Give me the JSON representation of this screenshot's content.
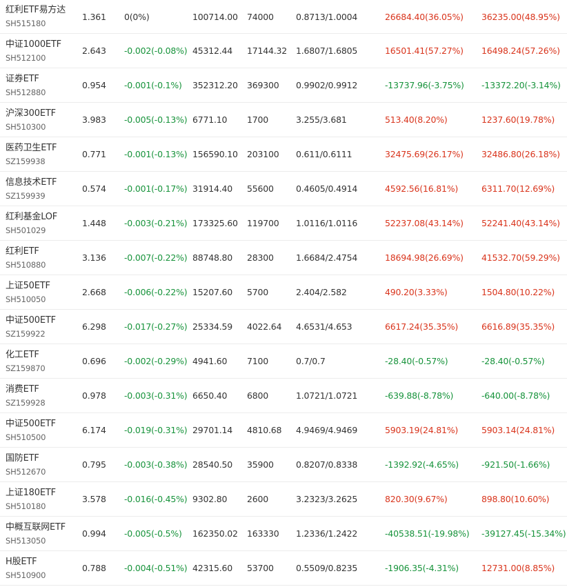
{
  "colors": {
    "up": "#d9341c",
    "down": "#17933b",
    "flat": "#333333"
  },
  "rows": [
    {
      "name": "红利ETF易方达",
      "code": "SH515180",
      "price": "1.361",
      "change": "0(0%)",
      "change_dir": "flat",
      "v1": "100714.00",
      "v2": "74000",
      "ratio": "0.8713/1.0004",
      "p1": "26684.40(36.05%)",
      "p1_dir": "up",
      "p2": "36235.00(48.95%)",
      "p2_dir": "up"
    },
    {
      "name": "中证1000ETF",
      "code": "SH512100",
      "price": "2.643",
      "change": "-0.002(-0.08%)",
      "change_dir": "down",
      "v1": "45312.44",
      "v2": "17144.32",
      "ratio": "1.6807/1.6805",
      "p1": "16501.41(57.27%)",
      "p1_dir": "up",
      "p2": "16498.24(57.26%)",
      "p2_dir": "up"
    },
    {
      "name": "证券ETF",
      "code": "SH512880",
      "price": "0.954",
      "change": "-0.001(-0.1%)",
      "change_dir": "down",
      "v1": "352312.20",
      "v2": "369300",
      "ratio": "0.9902/0.9912",
      "p1": "-13737.96(-3.75%)",
      "p1_dir": "down",
      "p2": "-13372.20(-3.14%)",
      "p2_dir": "down"
    },
    {
      "name": "沪深300ETF",
      "code": "SH510300",
      "price": "3.983",
      "change": "-0.005(-0.13%)",
      "change_dir": "down",
      "v1": "6771.10",
      "v2": "1700",
      "ratio": "3.255/3.681",
      "p1": "513.40(8.20%)",
      "p1_dir": "up",
      "p2": "1237.60(19.78%)",
      "p2_dir": "up"
    },
    {
      "name": "医药卫生ETF",
      "code": "SZ159938",
      "price": "0.771",
      "change": "-0.001(-0.13%)",
      "change_dir": "down",
      "v1": "156590.10",
      "v2": "203100",
      "ratio": "0.611/0.6111",
      "p1": "32475.69(26.17%)",
      "p1_dir": "up",
      "p2": "32486.80(26.18%)",
      "p2_dir": "up"
    },
    {
      "name": "信息技术ETF",
      "code": "SZ159939",
      "price": "0.574",
      "change": "-0.001(-0.17%)",
      "change_dir": "down",
      "v1": "31914.40",
      "v2": "55600",
      "ratio": "0.4605/0.4914",
      "p1": "4592.56(16.81%)",
      "p1_dir": "up",
      "p2": "6311.70(12.69%)",
      "p2_dir": "up"
    },
    {
      "name": "红利基金LOF",
      "code": "SH501029",
      "price": "1.448",
      "change": "-0.003(-0.21%)",
      "change_dir": "down",
      "v1": "173325.60",
      "v2": "119700",
      "ratio": "1.0116/1.0116",
      "p1": "52237.08(43.14%)",
      "p1_dir": "up",
      "p2": "52241.40(43.14%)",
      "p2_dir": "up"
    },
    {
      "name": "红利ETF",
      "code": "SH510880",
      "price": "3.136",
      "change": "-0.007(-0.22%)",
      "change_dir": "down",
      "v1": "88748.80",
      "v2": "28300",
      "ratio": "1.6684/2.4754",
      "p1": "18694.98(26.69%)",
      "p1_dir": "up",
      "p2": "41532.70(59.29%)",
      "p2_dir": "up"
    },
    {
      "name": "上证50ETF",
      "code": "SH510050",
      "price": "2.668",
      "change": "-0.006(-0.22%)",
      "change_dir": "down",
      "v1": "15207.60",
      "v2": "5700",
      "ratio": "2.404/2.582",
      "p1": "490.20(3.33%)",
      "p1_dir": "up",
      "p2": "1504.80(10.22%)",
      "p2_dir": "up"
    },
    {
      "name": "中证500ETF",
      "code": "SZ159922",
      "price": "6.298",
      "change": "-0.017(-0.27%)",
      "change_dir": "down",
      "v1": "25334.59",
      "v2": "4022.64",
      "ratio": "4.6531/4.653",
      "p1": "6617.24(35.35%)",
      "p1_dir": "up",
      "p2": "6616.89(35.35%)",
      "p2_dir": "up"
    },
    {
      "name": "化工ETF",
      "code": "SZ159870",
      "price": "0.696",
      "change": "-0.002(-0.29%)",
      "change_dir": "down",
      "v1": "4941.60",
      "v2": "7100",
      "ratio": "0.7/0.7",
      "p1": "-28.40(-0.57%)",
      "p1_dir": "down",
      "p2": "-28.40(-0.57%)",
      "p2_dir": "down"
    },
    {
      "name": "消费ETF",
      "code": "SZ159928",
      "price": "0.978",
      "change": "-0.003(-0.31%)",
      "change_dir": "down",
      "v1": "6650.40",
      "v2": "6800",
      "ratio": "1.0721/1.0721",
      "p1": "-639.88(-8.78%)",
      "p1_dir": "down",
      "p2": "-640.00(-8.78%)",
      "p2_dir": "down"
    },
    {
      "name": "中证500ETF",
      "code": "SH510500",
      "price": "6.174",
      "change": "-0.019(-0.31%)",
      "change_dir": "down",
      "v1": "29701.14",
      "v2": "4810.68",
      "ratio": "4.9469/4.9469",
      "p1": "5903.19(24.81%)",
      "p1_dir": "up",
      "p2": "5903.14(24.81%)",
      "p2_dir": "up"
    },
    {
      "name": "国防ETF",
      "code": "SH512670",
      "price": "0.795",
      "change": "-0.003(-0.38%)",
      "change_dir": "down",
      "v1": "28540.50",
      "v2": "35900",
      "ratio": "0.8207/0.8338",
      "p1": "-1392.92(-4.65%)",
      "p1_dir": "down",
      "p2": "-921.50(-1.66%)",
      "p2_dir": "down"
    },
    {
      "name": "上证180ETF",
      "code": "SH510180",
      "price": "3.578",
      "change": "-0.016(-0.45%)",
      "change_dir": "down",
      "v1": "9302.80",
      "v2": "2600",
      "ratio": "3.2323/3.2625",
      "p1": "820.30(9.67%)",
      "p1_dir": "up",
      "p2": "898.80(10.60%)",
      "p2_dir": "up"
    },
    {
      "name": "中概互联网ETF",
      "code": "SH513050",
      "price": "0.994",
      "change": "-0.005(-0.5%)",
      "change_dir": "down",
      "v1": "162350.02",
      "v2": "163330",
      "ratio": "1.2336/1.2422",
      "p1": "-40538.51(-19.98%)",
      "p1_dir": "down",
      "p2": "-39127.45(-15.34%)",
      "p2_dir": "down"
    },
    {
      "name": "H股ETF",
      "code": "SH510900",
      "price": "0.788",
      "change": "-0.004(-0.51%)",
      "change_dir": "down",
      "v1": "42315.60",
      "v2": "53700",
      "ratio": "0.5509/0.8235",
      "p1": "-1906.35(-4.31%)",
      "p1_dir": "down",
      "p2": "12731.00(8.85%)",
      "p2_dir": "up"
    }
  ]
}
